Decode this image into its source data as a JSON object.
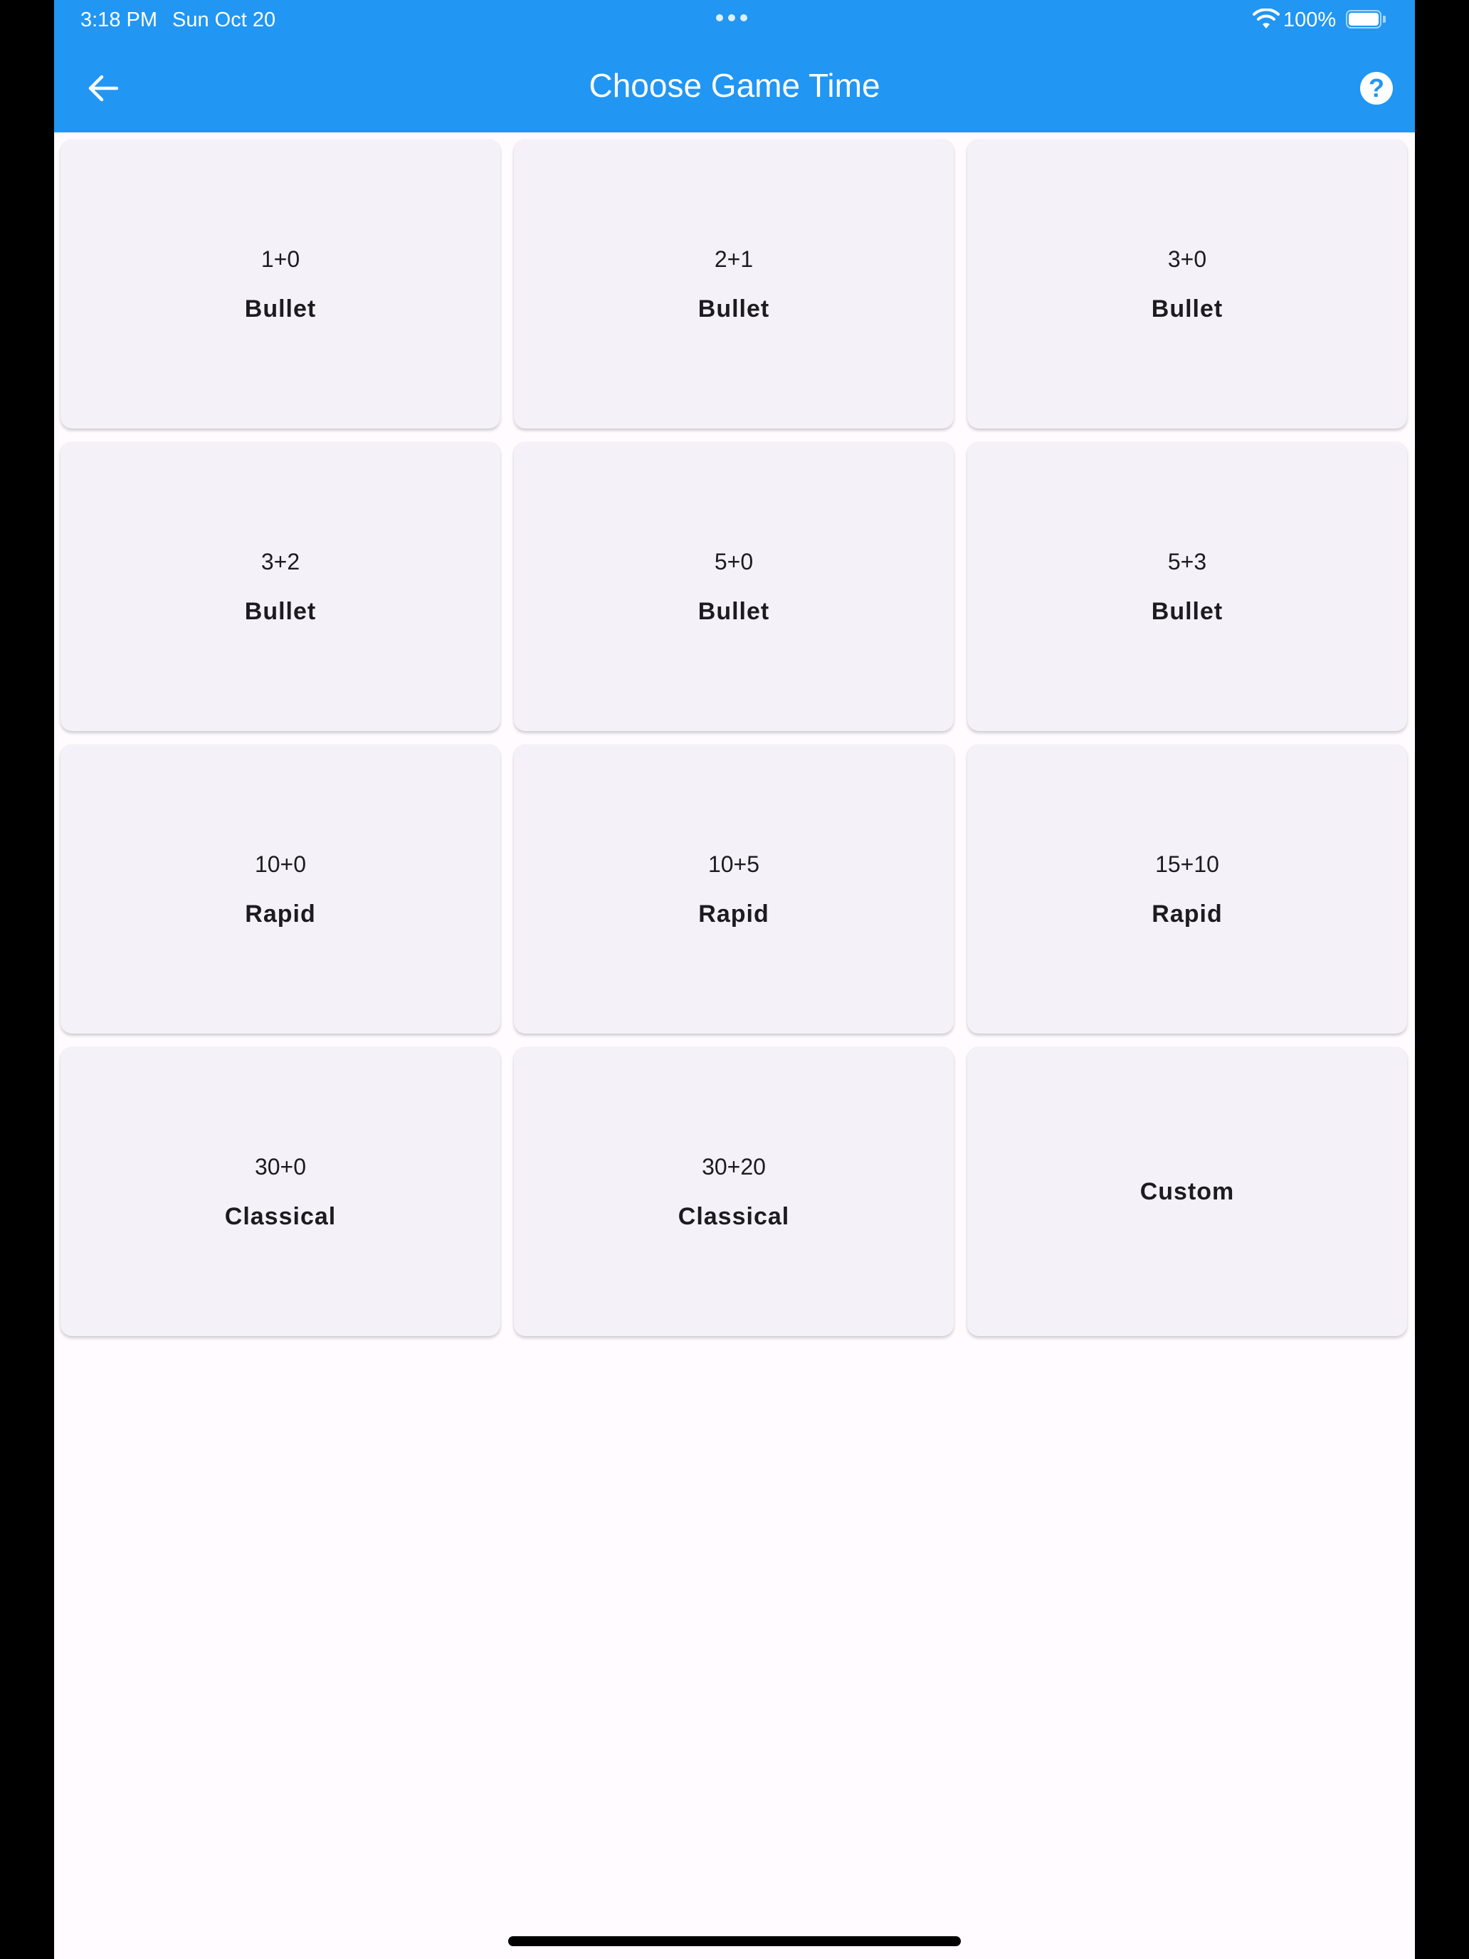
{
  "status_bar": {
    "time": "3:18 PM",
    "date": "Sun Oct 20",
    "battery": "100%",
    "battery_level": 1.0
  },
  "app_bar": {
    "title": "Choose Game Time",
    "back_icon": "arrow-left-icon",
    "help_icon": "help-circle-icon",
    "help_glyph": "?",
    "color": "#2196f3"
  },
  "options": [
    {
      "time": "1+0",
      "kind": "Bullet"
    },
    {
      "time": "2+1",
      "kind": "Bullet"
    },
    {
      "time": "3+0",
      "kind": "Bullet"
    },
    {
      "time": "3+2",
      "kind": "Bullet"
    },
    {
      "time": "5+0",
      "kind": "Bullet"
    },
    {
      "time": "5+3",
      "kind": "Bullet"
    },
    {
      "time": "10+0",
      "kind": "Rapid"
    },
    {
      "time": "10+5",
      "kind": "Rapid"
    },
    {
      "time": "15+10",
      "kind": "Rapid"
    },
    {
      "time": "30+0",
      "kind": "Classical"
    },
    {
      "time": "30+20",
      "kind": "Classical"
    },
    {
      "time": "",
      "kind": "Custom"
    }
  ]
}
